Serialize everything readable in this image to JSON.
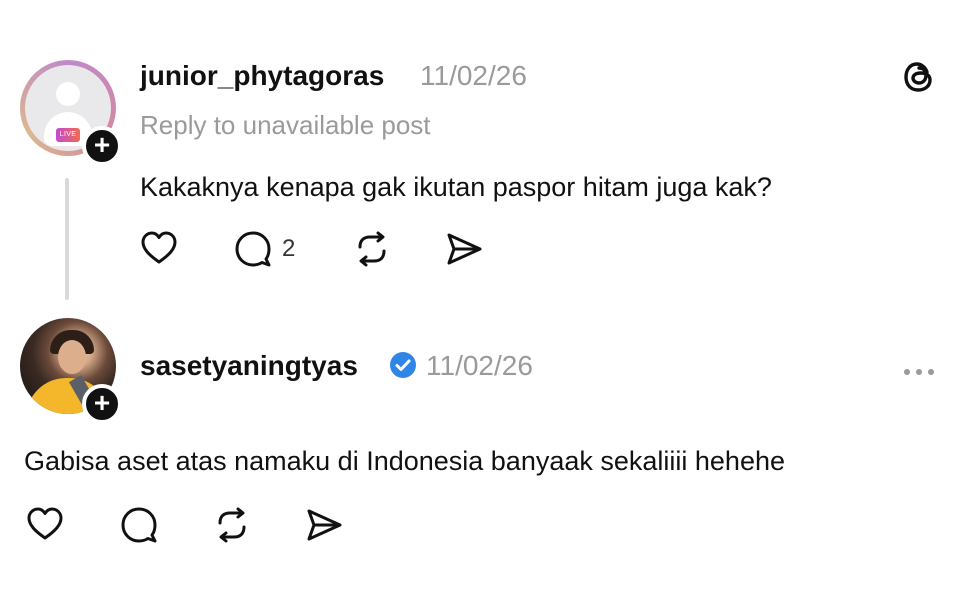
{
  "posts": [
    {
      "username": "junior_phytagoras",
      "date": "11/02/26",
      "reply_context": "Reply to unavailable post",
      "text": "Kakaknya kenapa gak ikutan paspor hitam juga kak?",
      "reply_count": "2",
      "live_badge": "LIVE",
      "follow_label": "+"
    },
    {
      "username": "sasetyaningtyas",
      "date": "11/02/26",
      "text": "Gabisa aset atas namaku di Indonesia banyaak sekaliiii hehehe",
      "follow_label": "+"
    }
  ],
  "icons": {
    "app_logo": "threads-logo-icon",
    "like": "heart-icon",
    "reply": "comment-icon",
    "repost": "repost-icon",
    "share": "send-icon",
    "more": "more-options-icon",
    "verified": "verified-badge-icon"
  },
  "colors": {
    "text": "#111111",
    "muted": "#9a9a9a",
    "verified": "#2f86e6",
    "thread_line": "#d9d9d9"
  }
}
